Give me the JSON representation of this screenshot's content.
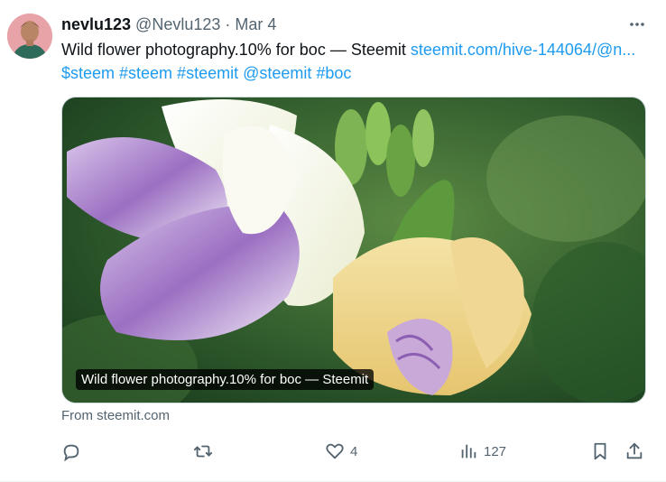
{
  "tweet": {
    "display_name": "nevlu123",
    "handle": "@Nevlu123",
    "separator": "·",
    "date": "Mar 4",
    "text_plain": "Wild flower photography.10% for boc — Steemit ",
    "text_link": "steemit.com/hive-144064/@n...",
    "hashtags": "$steem #steem #steemit @steemit #boc",
    "card_caption": "Wild flower photography.10% for boc — Steemit",
    "card_source": "From steemit.com",
    "likes": "4",
    "views": "127"
  },
  "icons": {
    "more": "more-icon",
    "reply": "reply-icon",
    "retweet": "retweet-icon",
    "like": "heart-icon",
    "views": "views-icon",
    "bookmark": "bookmark-icon",
    "share": "share-icon"
  },
  "colors": {
    "text": "#0f1419",
    "muted": "#536471",
    "link": "#1d9bf0",
    "border": "#cfd9de"
  }
}
